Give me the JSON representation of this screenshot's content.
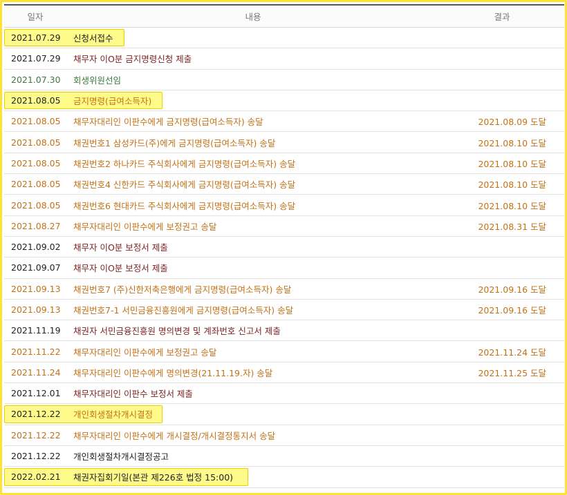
{
  "header": {
    "date": "일자",
    "content": "내용",
    "result": "결과"
  },
  "colors": {
    "highlight_fill": "#fffb8a",
    "highlight_border": "#f0cc00",
    "orange_text": "#c47116",
    "darkred_text": "#7a2424",
    "green_text": "#3a7a3a"
  },
  "rows": [
    {
      "date": "2021.07.29",
      "content": "신청서접수",
      "result": "",
      "style": "dark",
      "highlight": true
    },
    {
      "date": "2021.07.29",
      "content": "채무자 이O분 금지명령신청 제출",
      "result": "",
      "style": "darkred",
      "highlight": false
    },
    {
      "date": "2021.07.30",
      "content": "회생위원선임",
      "result": "",
      "style": "green",
      "highlight": false
    },
    {
      "date": "2021.08.05",
      "content": "금지명령(급여소득자)",
      "result": "",
      "style": "orange",
      "highlight": true
    },
    {
      "date": "2021.08.05",
      "content": "채무자대리인 이판수에게 금지명령(급여소득자) 송달",
      "result": "2021.08.09 도달",
      "style": "orange",
      "highlight": false
    },
    {
      "date": "2021.08.05",
      "content": "채권번호1 삼성카드(주)에게 금지명령(급여소득자) 송달",
      "result": "2021.08.10 도달",
      "style": "orange",
      "highlight": false
    },
    {
      "date": "2021.08.05",
      "content": "채권번호2 하나카드 주식회사에게 금지명령(급여소득자) 송달",
      "result": "2021.08.10 도달",
      "style": "orange",
      "highlight": false
    },
    {
      "date": "2021.08.05",
      "content": "채권번호4 신한카드 주식회사에게 금지명령(급여소득자) 송달",
      "result": "2021.08.10 도달",
      "style": "orange",
      "highlight": false
    },
    {
      "date": "2021.08.05",
      "content": "채권번호6 현대카드 주식회사에게 금지명령(급여소득자) 송달",
      "result": "2021.08.10 도달",
      "style": "orange",
      "highlight": false
    },
    {
      "date": "2021.08.27",
      "content": "채무자대리인 이판수에게 보정권고 송달",
      "result": "2021.08.31 도달",
      "style": "orange",
      "highlight": false
    },
    {
      "date": "2021.09.02",
      "content": "채무자 이O분 보정서 제출",
      "result": "",
      "style": "darkred",
      "highlight": false
    },
    {
      "date": "2021.09.07",
      "content": "채무자 이O분 보정서 제출",
      "result": "",
      "style": "darkred",
      "highlight": false
    },
    {
      "date": "2021.09.13",
      "content": "채권번호7 (주)신한저축은행에게 금지명령(급여소득자) 송달",
      "result": "2021.09.16 도달",
      "style": "orange",
      "highlight": false
    },
    {
      "date": "2021.09.13",
      "content": "채권번호7-1 서민금융진흥원에게 금지명령(급여소득자) 송달",
      "result": "2021.09.16 도달",
      "style": "orange",
      "highlight": false
    },
    {
      "date": "2021.11.19",
      "content": "채권자 서민금융진흥원 명의변경 및 계좌번호 신고서 제출",
      "result": "",
      "style": "darkred",
      "highlight": false
    },
    {
      "date": "2021.11.22",
      "content": "채무자대리인 이판수에게 보정권고 송달",
      "result": "2021.11.24 도달",
      "style": "orange",
      "highlight": false
    },
    {
      "date": "2021.11.24",
      "content": "채무자대리인 이판수에게 명의변경(21.11.19.자) 송달",
      "result": "2021.11.25 도달",
      "style": "orange",
      "highlight": false
    },
    {
      "date": "2021.12.01",
      "content": "채무자대리인 이판수 보정서 제출",
      "result": "",
      "style": "darkred",
      "highlight": false
    },
    {
      "date": "2021.12.22",
      "content": "개인회생절차개시결정",
      "result": "",
      "style": "orange",
      "highlight": true
    },
    {
      "date": "2021.12.22",
      "content": "채무자대리인 이판수에게 개시결정/개시결정통지서 송달",
      "result": "",
      "style": "orange",
      "highlight": false
    },
    {
      "date": "2021.12.22",
      "content": "개인회생절차개시결정공고",
      "result": "",
      "style": "dark",
      "highlight": false
    },
    {
      "date": "2022.02.21",
      "content": "채권자집회기일(본관 제226호 법정 15:00)",
      "result": "",
      "style": "dark",
      "highlight": true
    }
  ]
}
